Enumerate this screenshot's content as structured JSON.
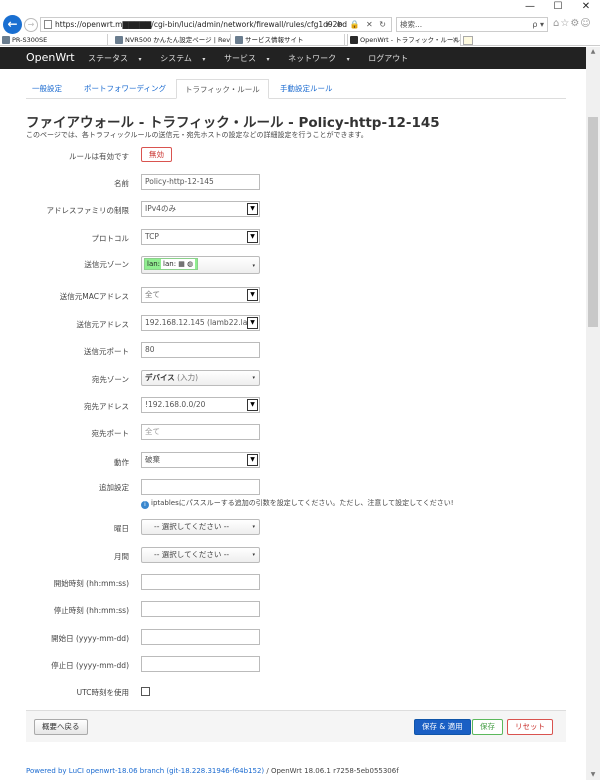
{
  "browser": {
    "url": "https://openwrt.m▇▇▇▇▇/cgi-bin/luci/admin/network/firewall/rules/cfg1d92bd",
    "url_tools": "▾ ⊕ 🔒 ✕ ↻",
    "search_placeholder": "検索...",
    "search_tools": "ρ ▾",
    "right_icons": "⌂☆⚙☺",
    "window_buttons": [
      "—",
      "☐",
      "✕"
    ],
    "tabs": [
      {
        "label": "PR-S300SE",
        "active": false
      },
      {
        "label": "NVR500 かんたん設定ページ | Rev...",
        "active": false
      },
      {
        "label": "サービス情報サイト",
        "active": false
      },
      {
        "label": "OpenWrt - トラフィック・ルール -...",
        "active": true
      }
    ],
    "tab_close": "✕"
  },
  "nav": {
    "brand": "OpenWrt",
    "menu": [
      "ステータス",
      "システム",
      "サービス",
      "ネットワーク",
      "ログアウト"
    ],
    "caret": "▾"
  },
  "subtabs": [
    "一般設定",
    "ポートフォワーディング",
    "トラフィック・ルール",
    "手動設定ルール"
  ],
  "page": {
    "title": "ファイアウォール - トラフィック・ルール - Policy-http-12-145",
    "description": "このページでは、各トラフィックルールの送信元・宛先ホストの設定などの詳細設定を行うことができます。"
  },
  "form": {
    "enabled_label": "ルールは有効です",
    "enabled_button": "無効",
    "name_label": "名前",
    "name_value": "Policy-http-12-145",
    "family_label": "アドレスファミリの制限",
    "family_value": "IPv4のみ",
    "protocol_label": "プロトコル",
    "protocol_value": "TCP",
    "src_zone_label": "送信元ゾーン",
    "src_zone_chip": "lan:",
    "src_zone_inner": "lan:",
    "src_zone_icons": "▦ ◍",
    "src_mac_label": "送信元MACアドレス",
    "src_mac_value": "全て",
    "src_addr_label": "送信元アドレス",
    "src_addr_value": "192.168.12.145 (lamb22.lan)",
    "src_port_label": "送信元ポート",
    "src_port_value": "80",
    "dest_zone_label": "宛先ゾーン",
    "dest_zone_value": "デバイス",
    "dest_zone_suffix": "(入力)",
    "dest_addr_label": "宛先アドレス",
    "dest_addr_value": "!192.168.0.0/20",
    "dest_port_label": "宛先ポート",
    "dest_port_placeholder": "全て",
    "action_label": "動作",
    "action_value": "破棄",
    "extra_label": "追加設定",
    "extra_hint": "iptablesにパススルーする追加の引数を設定してください。ただし、注意して設定してください!",
    "weekdays_label": "曜日",
    "weekdays_value": "-- 選択してください --",
    "monthdays_label": "月間",
    "monthdays_value": "-- 選択してください --",
    "start_time_label": "開始時刻 (hh:mm:ss)",
    "stop_time_label": "停止時刻 (hh:mm:ss)",
    "start_date_label": "開始日 (yyyy-mm-dd)",
    "stop_date_label": "停止日 (yyyy-mm-dd)",
    "utc_label": "UTC時刻を使用",
    "select_arrow": "▼",
    "dd_caret": "▾"
  },
  "footer": {
    "back": "概要へ戻る",
    "save_apply": "保存 & 適用",
    "save": "保存",
    "reset": "リセット"
  },
  "powered": {
    "link_text": "Powered by LuCI openwrt-18.06 branch (git-18.228.31946-f64b152)",
    "suffix": " / OpenWrt 18.06.1 r7258-5eb055306f"
  }
}
